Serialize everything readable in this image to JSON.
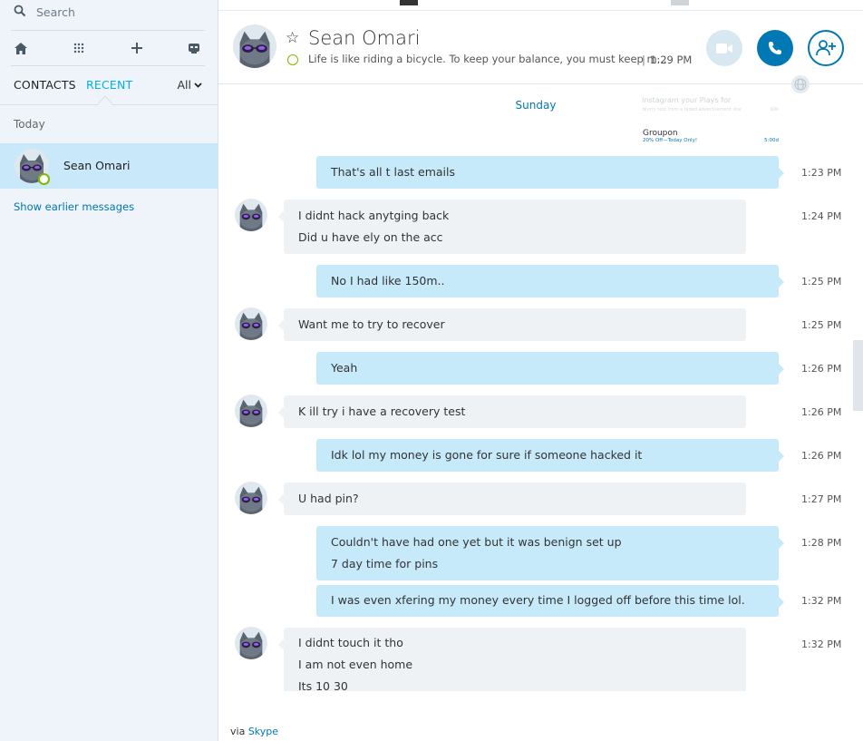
{
  "sidebar": {
    "search": {
      "placeholder": "Search"
    },
    "nav": {
      "home_icon": "home-icon",
      "dialpad_icon": "dialpad-icon",
      "add_icon": "plus-icon",
      "bot_icon": "bot-icon"
    },
    "tabs": {
      "contacts": "CONTACTS",
      "recent": "RECENT",
      "filter": "All"
    },
    "section_label": "Today",
    "contacts": [
      {
        "name": "Sean Omari",
        "presence": "online"
      }
    ],
    "show_earlier": "Show earlier messages"
  },
  "conversation": {
    "title": "Sean Omari",
    "mood": "Life is like riding a bicycle. To keep your balance, you must keep m...",
    "separator": "|",
    "last_seen": "1:29 PM",
    "day": "Sunday",
    "ad": {
      "ghost_line_1": "Instagram your Plays for",
      "ghost_line_2": "blurry text from a faded advertisement line",
      "ghost_price": "$9k",
      "title": "Groupon",
      "subtitle": "20% Off—Today Only!",
      "price": "5:00d"
    },
    "messages": [
      {
        "dir": "out",
        "lines": [
          "That's all t last emails"
        ],
        "time": "1:23 PM"
      },
      {
        "dir": "in",
        "lines": [
          "I didnt hack anytging back",
          "Did u have ely on the acc"
        ],
        "time": "1:24 PM"
      },
      {
        "dir": "out",
        "lines": [
          "No I had like 150m.."
        ],
        "time": "1:25 PM"
      },
      {
        "dir": "in",
        "lines": [
          "Want me to try to recover"
        ],
        "time": "1:25 PM"
      },
      {
        "dir": "out",
        "lines": [
          "Yeah"
        ],
        "time": "1:26 PM"
      },
      {
        "dir": "in",
        "lines": [
          "K ill try i have a recovery test"
        ],
        "time": "1:26 PM"
      },
      {
        "dir": "out",
        "lines": [
          "Idk lol my money is gone for sure if someone hacked it"
        ],
        "time": "1:26 PM"
      },
      {
        "dir": "in",
        "lines": [
          "U had pin?"
        ],
        "time": "1:27 PM"
      },
      {
        "dir": "out",
        "lines": [
          "Couldn't have had one yet but it was benign set up",
          "7 day time for pins"
        ],
        "time": "1:28 PM"
      },
      {
        "dir": "out",
        "lines": [
          "I was even xfering my money every time I logged off before this time lol."
        ],
        "time": "1:32 PM"
      },
      {
        "dir": "in",
        "lines": [
          "I didnt touch it tho",
          "I am not even home",
          "Its 10 30"
        ],
        "time": "1:32 PM"
      }
    ],
    "via_prefix": "via",
    "via_link": "Skype"
  },
  "colors": {
    "accent": "#0078b4",
    "skype_blue": "#00aff0",
    "outgoing_bubble": "#c7eafb",
    "incoming_bubble": "#eff2f5",
    "presence_online": "#7fba00"
  }
}
